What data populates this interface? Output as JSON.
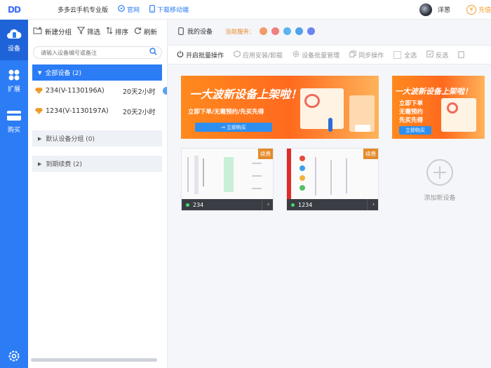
{
  "app": {
    "logo": "DD",
    "title": "多多云手机专业版"
  },
  "top_links": {
    "official": "官网",
    "download": "下载移动端"
  },
  "user": {
    "name": "洋葱",
    "vip_label": "充值"
  },
  "rail": {
    "devices": "设备",
    "extend": "扩展",
    "buy": "购买"
  },
  "panel_tools": {
    "new_group": "新建分组",
    "filter": "筛选",
    "sort": "排序",
    "refresh": "刷新"
  },
  "search": {
    "placeholder": "请输入设备编号或备注"
  },
  "groups": {
    "all": "全部设备 (2)",
    "default": "默认设备分组 (0)",
    "expiring": "到期续费 (2)"
  },
  "devices": [
    {
      "name": "234(V-1130196A)",
      "time": "20天2小时"
    },
    {
      "name": "1234(V-1130197A)",
      "time": "20天2小时"
    }
  ],
  "right_header": {
    "my_devices": "我的设备",
    "current_service": "当前服务："
  },
  "service_colors": [
    "#f29a6a",
    "#f07f7f",
    "#5bb4f0",
    "#4fa3e8",
    "#6a84f0"
  ],
  "toolbar": {
    "batch": "开启批量操作",
    "app_install": "应用安装/卸载",
    "batch_manage": "设备批量管理",
    "sync": "同步操作",
    "select_all": "全选",
    "invert": "反选"
  },
  "banner": {
    "headline": "一大波新设备上架啦！",
    "subline": "立即下单/无需预约/先买先得",
    "cta": "→ 立即购买",
    "small_lines": [
      "立即下单",
      "无需预约",
      "先买先得"
    ],
    "small_cta": "立即购买"
  },
  "cards": [
    {
      "label": "234",
      "renew": "续费"
    },
    {
      "label": "1234",
      "renew": "续费"
    }
  ],
  "add_device": "添加新设备"
}
